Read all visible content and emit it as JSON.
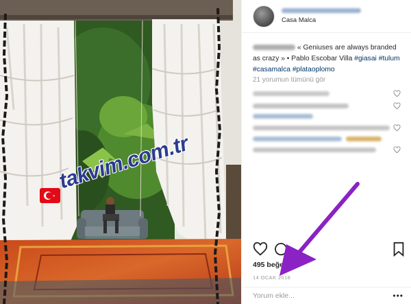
{
  "post": {
    "account_name": "Casa Malca",
    "caption": {
      "quote": "« Geniuses are always branded as crazy » • Pablo Escobar Villa ",
      "hashtags": [
        "#giasai",
        "#tulum",
        "#casamalca",
        "#plataoplomo"
      ]
    },
    "view_all_comments": "21 yorumun tümünü gör",
    "likes": "495 beğenme",
    "date": "14 OCAK 2018",
    "comment_placeholder": "Yorum ekle...",
    "more_options": "•••"
  },
  "photo": {
    "watermark_text": "takvim.com.tr",
    "arrow_color": "#8b22c4"
  },
  "icons": {
    "like": "heart-icon",
    "comment": "comment-icon",
    "save": "bookmark-icon",
    "comment_like": "heart-icon"
  }
}
